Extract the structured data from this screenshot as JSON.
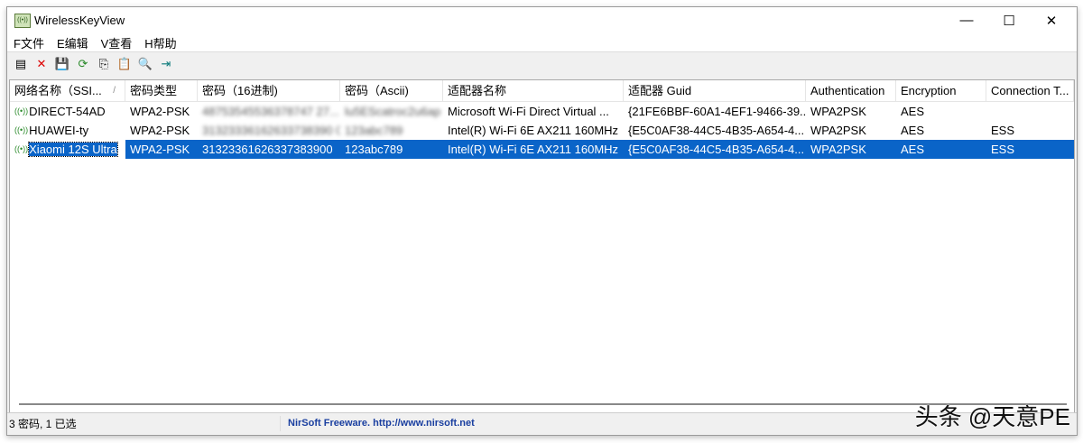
{
  "window": {
    "title": "WirelessKeyView",
    "min": "—",
    "max": "☐",
    "close": "✕"
  },
  "menu": [
    "F文件",
    "E编辑",
    "V查看",
    "H帮助"
  ],
  "toolbar": [
    {
      "icon": "properties-icon",
      "glyph": "▤"
    },
    {
      "icon": "delete-icon",
      "glyph": "✕"
    },
    {
      "icon": "save-icon",
      "glyph": "💾"
    },
    {
      "icon": "refresh-icon",
      "glyph": "⟳"
    },
    {
      "icon": "copy-icon",
      "glyph": "⎘"
    },
    {
      "icon": "report-icon",
      "glyph": "📋"
    },
    {
      "icon": "find-icon",
      "glyph": "🔍"
    },
    {
      "icon": "exit-icon",
      "glyph": "⇥"
    }
  ],
  "columns": [
    "网络名称（SSI...",
    "密码类型",
    "密码（16进制)",
    "密码（Ascii)",
    "适配器名称",
    "适配器 Guid",
    "Authentication",
    "Encryption",
    "Connection T..."
  ],
  "sort_indicator": "/",
  "rows": [
    [
      "DIRECT-54AD",
      "WPA2-PSK",
      "48753545536378747 27...",
      "lu5EScatroc2u6ap",
      "Microsoft Wi-Fi Direct Virtual ...",
      "{21FE6BBF-60A1-4EF1-9466-39...",
      "WPA2PSK",
      "AES",
      ""
    ],
    [
      "HUAWEI-ty",
      "WPA2-PSK",
      "31323336162633738390 0",
      "123abc789",
      "Intel(R) Wi-Fi 6E AX211 160MHz",
      "{E5C0AF38-44C5-4B35-A654-4...",
      "WPA2PSK",
      "AES",
      "ESS"
    ],
    [
      "Xiaomi 12S Ultra",
      "WPA2-PSK",
      "31323361626337383900",
      "123abc789",
      "Intel(R) Wi-Fi 6E AX211 160MHz",
      "{E5C0AF38-44C5-4B35-A654-4...",
      "WPA2PSK",
      "AES",
      "ESS"
    ]
  ],
  "selected_row": 2,
  "status": {
    "count": "3 密码, 1 已选",
    "credit": "NirSoft Freeware.  http://www.nirsoft.net"
  },
  "watermark": "头条 @天意PE",
  "colors": {
    "selection": "#0a64c8",
    "link": "#1a3fa0"
  }
}
